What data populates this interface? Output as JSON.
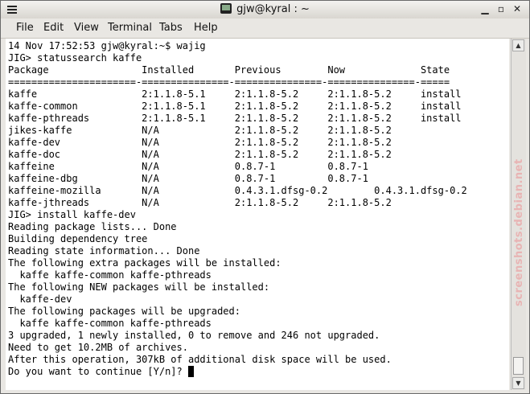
{
  "window": {
    "title": "gjw@kyral : ~"
  },
  "menubar": [
    "File",
    "Edit",
    "View",
    "Terminal",
    "Tabs",
    "Help"
  ],
  "terminal_lines": [
    "14 Nov 17:52:53 gjw@kyral:~$ wajig",
    "JIG> statussearch kaffe",
    "Package                Installed       Previous        Now             State",
    "======================-===============-===============-===============-=====",
    "kaffe                  2:1.1.8-5.1     2:1.1.8-5.2     2:1.1.8-5.2     install",
    "kaffe-common           2:1.1.8-5.1     2:1.1.8-5.2     2:1.1.8-5.2     install",
    "kaffe-pthreads         2:1.1.8-5.1     2:1.1.8-5.2     2:1.1.8-5.2     install",
    "jikes-kaffe            N/A             2:1.1.8-5.2     2:1.1.8-5.2",
    "kaffe-dev              N/A             2:1.1.8-5.2     2:1.1.8-5.2",
    "kaffe-doc              N/A             2:1.1.8-5.2     2:1.1.8-5.2",
    "kaffeine               N/A             0.8.7-1         0.8.7-1",
    "kaffeine-dbg           N/A             0.8.7-1         0.8.7-1",
    "kaffeine-mozilla       N/A             0.4.3.1.dfsg-0.2        0.4.3.1.dfsg-0.2",
    "kaffe-jthreads         N/A             2:1.1.8-5.2     2:1.1.8-5.2",
    "JIG> install kaffe-dev",
    "Reading package lists... Done",
    "Building dependency tree",
    "Reading state information... Done",
    "The following extra packages will be installed:",
    "  kaffe kaffe-common kaffe-pthreads",
    "The following NEW packages will be installed:",
    "  kaffe-dev",
    "The following packages will be upgraded:",
    "  kaffe kaffe-common kaffe-pthreads",
    "3 upgraded, 1 newly installed, 0 to remove and 246 not upgraded.",
    "Need to get 10.2MB of archives.",
    "After this operation, 307kB of additional disk space will be used.",
    "Do you want to continue [Y/n]? "
  ],
  "watermark": "screenshots.debian.net",
  "colors": {
    "terminal_bg": "#ffffff",
    "terminal_fg": "#000000",
    "chrome": "#e9e7e3"
  },
  "icons": {
    "window_menu": "menu-icon",
    "terminal": "terminal-icon",
    "minimize": "minimize-icon",
    "maximize": "maximize-icon",
    "close": "close-icon"
  }
}
